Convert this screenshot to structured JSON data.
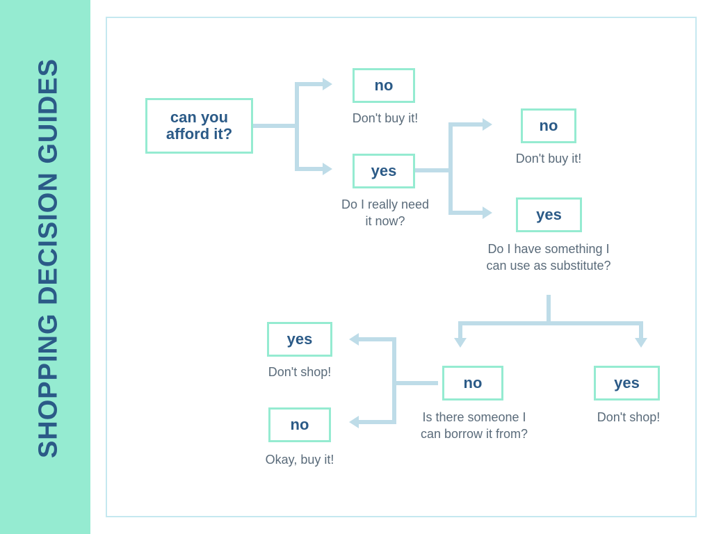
{
  "sidebar": {
    "title": "SHOPPING DECISION GUIDES"
  },
  "flow": {
    "q_afford": {
      "label": "can you afford it?"
    },
    "afford_no": {
      "label": "no",
      "caption": "Don't buy it!"
    },
    "afford_yes": {
      "label": "yes",
      "caption": "Do I really need it now?"
    },
    "need_no": {
      "label": "no",
      "caption": "Don't buy it!"
    },
    "need_yes": {
      "label": "yes",
      "caption": "Do I have something I can use as substitute?"
    },
    "sub_no": {
      "label": "no",
      "caption": "Is there someone I can borrow it from?"
    },
    "sub_yes": {
      "label": "yes",
      "caption": "Don't shop!"
    },
    "borrow_yes": {
      "label": "yes",
      "caption": "Don't shop!"
    },
    "borrow_no": {
      "label": "no",
      "caption": "Okay, buy it!"
    }
  }
}
